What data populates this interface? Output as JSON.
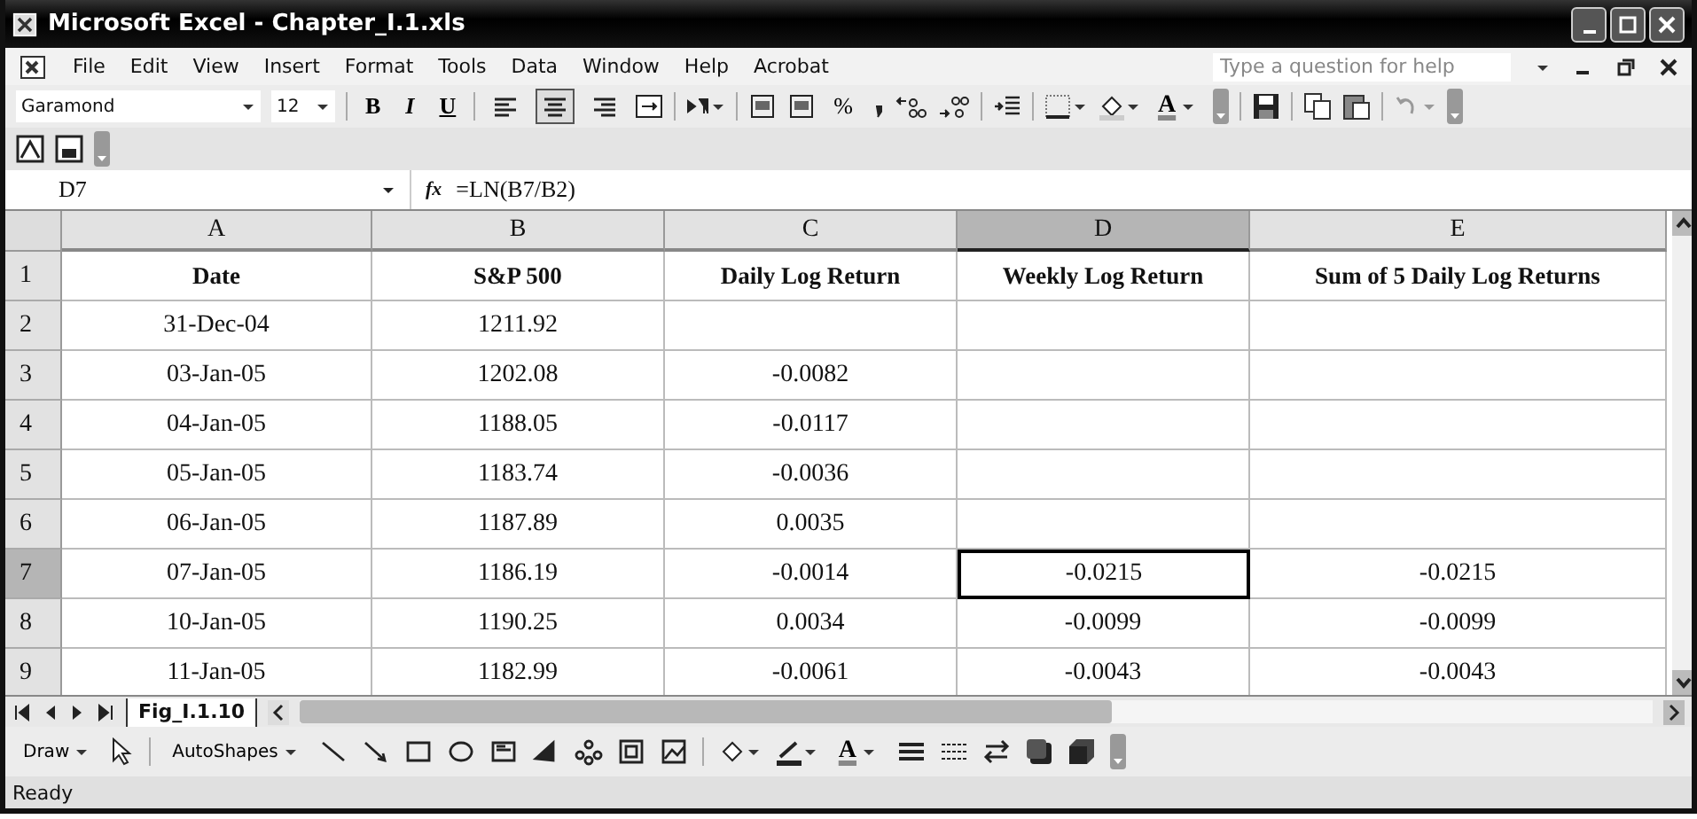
{
  "window": {
    "title": "Microsoft Excel - Chapter_I.1.xls"
  },
  "menu": [
    {
      "label": "File"
    },
    {
      "label": "Edit"
    },
    {
      "label": "View"
    },
    {
      "label": "Insert"
    },
    {
      "label": "Format"
    },
    {
      "label": "Tools"
    },
    {
      "label": "Data"
    },
    {
      "label": "Window"
    },
    {
      "label": "Help"
    },
    {
      "label": "Acrobat"
    }
  ],
  "help_box": {
    "placeholder": "Type a question for help"
  },
  "format_toolbar": {
    "font": "Garamond",
    "size": "12",
    "bold": "B",
    "italic": "I",
    "underline": "U",
    "percent": "%",
    "font_color": "A",
    "align": [
      {
        "selected": false
      },
      {
        "selected": true
      },
      {
        "selected": false
      }
    ]
  },
  "formula_bar": {
    "name_box": "D7",
    "fx": "fx",
    "formula": "=LN(B7/B2)"
  },
  "table": {
    "columns": [
      {
        "label": "A",
        "selected": false
      },
      {
        "label": "B",
        "selected": false
      },
      {
        "label": "C",
        "selected": false
      },
      {
        "label": "D",
        "selected": true
      },
      {
        "label": "E",
        "selected": false
      }
    ],
    "rows": [
      {
        "label": "1",
        "selected": false,
        "cells": [
          "Date",
          "S&P 500",
          "Daily Log Return",
          "Weekly Log Return",
          "Sum of 5 Daily Log Returns"
        ]
      },
      {
        "label": "2",
        "selected": false,
        "cells": [
          "31-Dec-04",
          "1211.92",
          "",
          "",
          ""
        ]
      },
      {
        "label": "3",
        "selected": false,
        "cells": [
          "03-Jan-05",
          "1202.08",
          "-0.0082",
          "",
          ""
        ]
      },
      {
        "label": "4",
        "selected": false,
        "cells": [
          "04-Jan-05",
          "1188.05",
          "-0.0117",
          "",
          ""
        ]
      },
      {
        "label": "5",
        "selected": false,
        "cells": [
          "05-Jan-05",
          "1183.74",
          "-0.0036",
          "",
          ""
        ]
      },
      {
        "label": "6",
        "selected": false,
        "cells": [
          "06-Jan-05",
          "1187.89",
          "0.0035",
          "",
          ""
        ]
      },
      {
        "label": "7",
        "selected": true,
        "cells": [
          "07-Jan-05",
          "1186.19",
          "-0.0014",
          "-0.0215",
          "-0.0215"
        ]
      },
      {
        "label": "8",
        "selected": false,
        "cells": [
          "10-Jan-05",
          "1190.25",
          "0.0034",
          "-0.0099",
          "-0.0099"
        ]
      },
      {
        "label": "9",
        "selected": false,
        "cells": [
          "11-Jan-05",
          "1182.99",
          "-0.0061",
          "-0.0043",
          "-0.0043"
        ]
      }
    ]
  },
  "sheet_tabs": [
    {
      "label": "Fig_I.1.10",
      "selected": true
    }
  ],
  "drawing_toolbar": {
    "draw": "Draw",
    "autoshapes": "AutoShapes",
    "font_color": "A"
  },
  "status_bar": {
    "text": "Ready"
  }
}
